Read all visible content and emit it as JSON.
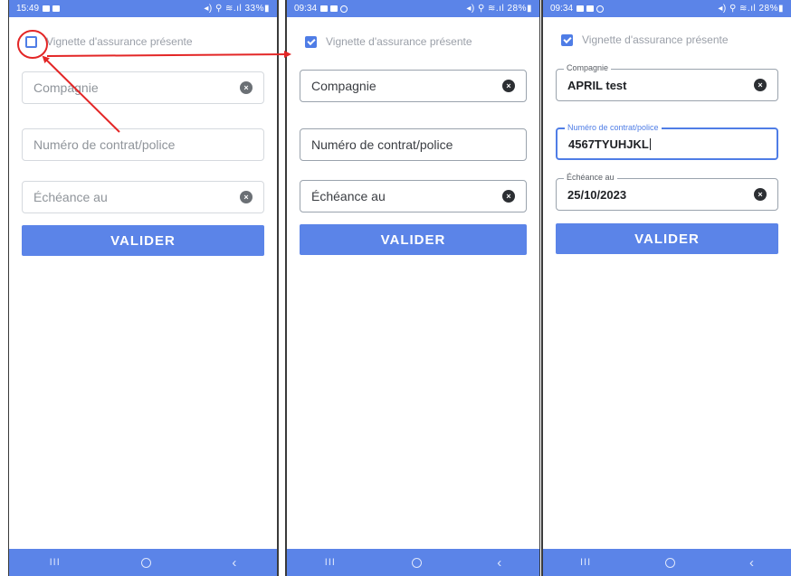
{
  "panels": [
    {
      "status": {
        "time": "15:49",
        "right": "◂) ⚲ ≋.ıl 33%▮"
      },
      "checkbox": {
        "label": "Vignette d'assurance présente",
        "checked": false
      },
      "fields": [
        {
          "placeholder": "Compagnie"
        },
        {
          "placeholder": "Numéro de contrat/police"
        },
        {
          "placeholder": "Échéance au"
        }
      ],
      "button": "VALIDER",
      "nav": {
        "recent": "III",
        "back": "‹"
      }
    },
    {
      "status": {
        "time": "09:34",
        "right": "◂) ⚲ ≋.ıl 28%▮"
      },
      "checkbox": {
        "label": "Vignette d'assurance présente",
        "checked": true
      },
      "fields": [
        {
          "placeholder": "Compagnie"
        },
        {
          "placeholder": "Numéro de contrat/police"
        },
        {
          "placeholder": "Échéance au"
        }
      ],
      "button": "VALIDER",
      "nav": {
        "recent": "III",
        "back": "‹"
      }
    },
    {
      "status": {
        "time": "09:34",
        "right": "◂) ⚲ ≋.ıl 28%▮"
      },
      "checkbox": {
        "label": "Vignette d'assurance présente",
        "checked": true
      },
      "fields": [
        {
          "label": "Compagnie",
          "value": "APRIL test"
        },
        {
          "label": "Numéro de contrat/police",
          "value": "4567TYUHJKL"
        },
        {
          "label": "Échéance au",
          "value": "25/10/2023"
        }
      ],
      "button": "VALIDER",
      "nav": {
        "recent": "III",
        "back": "‹"
      }
    }
  ],
  "icons": {
    "clear": "clear-icon",
    "checkbox": "checkbox-icon",
    "nav_home": "home-icon"
  },
  "colors": {
    "accent": "#5b84e8",
    "checkbox": "#4f7de6",
    "annotation": "#e32626"
  }
}
